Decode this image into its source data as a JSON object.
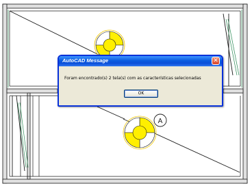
{
  "drawing": {
    "tag_label": "A",
    "colors": {
      "walls": "#1a1a1a",
      "wall_fill": "#d9d9d9",
      "hatch": "#2e8b57",
      "symbol": "#ffef00",
      "symbol_outline": "#f0c800",
      "background": "#ffffff"
    }
  },
  "dialog": {
    "title": "AutoCAD Message",
    "message": "Foram encontrado(s) 2 tela(s) com as características selecionadas",
    "ok_label": "OK",
    "close_icon": "close-icon",
    "colors": {
      "titlebar": "#0b4fd8",
      "body": "#ece9d8",
      "close": "#d9452a"
    }
  }
}
